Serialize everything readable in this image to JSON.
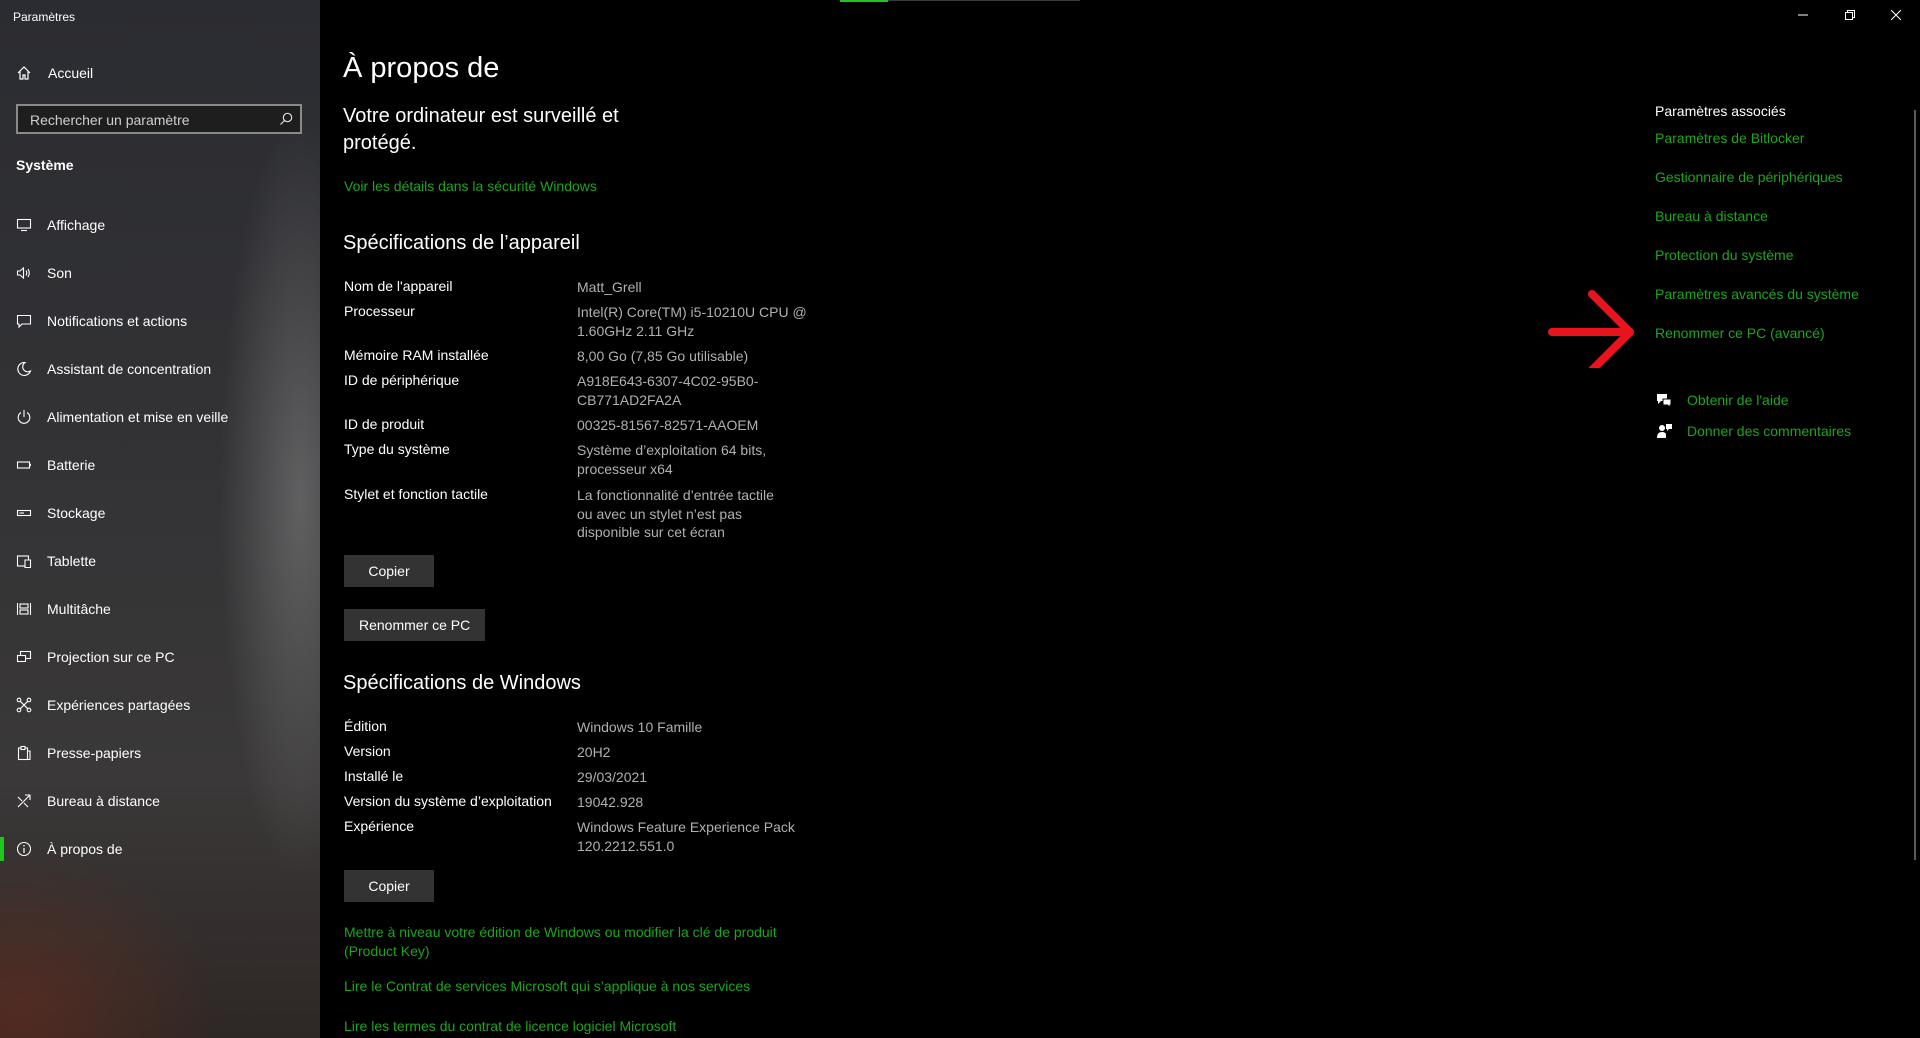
{
  "window": {
    "title": "Paramètres",
    "controls": [
      "minimize",
      "restore",
      "close"
    ]
  },
  "sidebar": {
    "home_label": "Accueil",
    "search_placeholder": "Rechercher un paramètre",
    "section_title": "Système",
    "items": [
      {
        "label": "Affichage",
        "icon": "display-icon"
      },
      {
        "label": "Son",
        "icon": "speaker-icon"
      },
      {
        "label": "Notifications et actions",
        "icon": "notification-icon"
      },
      {
        "label": "Assistant de concentration",
        "icon": "moon-icon"
      },
      {
        "label": "Alimentation et mise en veille",
        "icon": "power-icon"
      },
      {
        "label": "Batterie",
        "icon": "battery-icon"
      },
      {
        "label": "Stockage",
        "icon": "storage-icon"
      },
      {
        "label": "Tablette",
        "icon": "tablet-icon"
      },
      {
        "label": "Multitâche",
        "icon": "multitask-icon"
      },
      {
        "label": "Projection sur ce PC",
        "icon": "projection-icon"
      },
      {
        "label": "Expériences partagées",
        "icon": "shared-icon"
      },
      {
        "label": "Presse-papiers",
        "icon": "clipboard-icon"
      },
      {
        "label": "Bureau à distance",
        "icon": "remote-desktop-icon"
      },
      {
        "label": "À propos de",
        "icon": "info-icon",
        "active": true
      }
    ],
    "accent_color": "#1ec61e"
  },
  "main": {
    "title": "À propos de",
    "security_message": "Votre ordinateur est surveillé et protégé.",
    "security_link": "Voir les détails dans la sécurité Windows",
    "device_specs": {
      "heading": "Spécifications de l’appareil",
      "rows": [
        {
          "label": "Nom de l'appareil",
          "value": "Matt_Grell"
        },
        {
          "label": "Processeur",
          "value": "Intel(R) Core(TM) i5-10210U CPU @ 1.60GHz   2.11 GHz"
        },
        {
          "label": "Mémoire RAM installée",
          "value": "8,00 Go (7,85 Go utilisable)"
        },
        {
          "label": "ID de périphérique",
          "value": "A918E643-6307-4C02-95B0-CB771AD2FA2A"
        },
        {
          "label": "ID de produit",
          "value": "00325-81567-82571-AAOEM"
        },
        {
          "label": "Type du système",
          "value": "Système d’exploitation 64 bits, processeur x64"
        },
        {
          "label": "Stylet et fonction tactile",
          "value": "La fonctionnalité d’entrée tactile ou avec un stylet n’est pas disponible sur cet écran"
        }
      ],
      "copy_button": "Copier",
      "rename_button": "Renommer ce PC"
    },
    "windows_specs": {
      "heading": "Spécifications de Windows",
      "rows": [
        {
          "label": "Édition",
          "value": "Windows 10 Famille"
        },
        {
          "label": "Version",
          "value": "20H2"
        },
        {
          "label": "Installé le",
          "value": "29/03/2021"
        },
        {
          "label": "Version du système d’exploitation",
          "value": "19042.928"
        },
        {
          "label": "Expérience",
          "value": "Windows Feature Experience Pack 120.2212.551.0"
        }
      ],
      "copy_button": "Copier"
    },
    "bottom_links": [
      "Mettre à niveau votre édition de Windows ou modifier la clé de produit (Product Key)",
      "Lire le Contrat de services Microsoft qui s’applique à nos services",
      "Lire les termes du contrat de licence logiciel Microsoft"
    ],
    "link_color": "#1ea41e"
  },
  "related": {
    "title": "Paramètres associés",
    "links": [
      "Paramètres de Bitlocker",
      "Gestionnaire de périphériques",
      "Bureau à distance",
      "Protection du système",
      "Paramètres avancés du système",
      "Renommer ce PC (avancé)"
    ],
    "help_link": "Obtenir de l'aide",
    "feedback_link": "Donner des commentaires"
  },
  "annotation": {
    "arrow_color": "#e8141c"
  }
}
